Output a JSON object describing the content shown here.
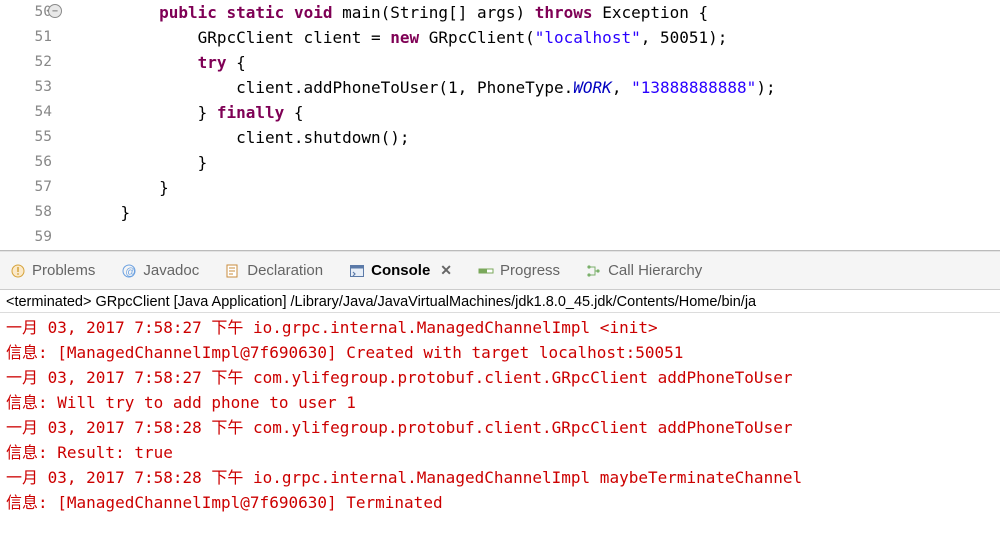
{
  "code": {
    "lines": [
      {
        "num": "50",
        "marker": true,
        "indent": "        ",
        "tokens": [
          {
            "cls": "kw",
            "t": "public"
          },
          {
            "t": " "
          },
          {
            "cls": "kw",
            "t": "static"
          },
          {
            "t": " "
          },
          {
            "cls": "kw",
            "t": "void"
          },
          {
            "t": " main(String[] args) "
          },
          {
            "cls": "kw",
            "t": "throws"
          },
          {
            "t": " Exception {"
          }
        ]
      },
      {
        "num": "51",
        "indent": "            ",
        "tokens": [
          {
            "t": "GRpcClient client = "
          },
          {
            "cls": "kw",
            "t": "new"
          },
          {
            "t": " GRpcClient("
          },
          {
            "cls": "str",
            "t": "\"localhost\""
          },
          {
            "t": ", 50051);"
          }
        ]
      },
      {
        "num": "52",
        "indent": "            ",
        "tokens": [
          {
            "cls": "kw",
            "t": "try"
          },
          {
            "t": " {"
          }
        ]
      },
      {
        "num": "53",
        "indent": "                ",
        "tokens": [
          {
            "t": "client.addPhoneToUser(1, PhoneType."
          },
          {
            "cls": "fld",
            "t": "WORK"
          },
          {
            "t": ", "
          },
          {
            "cls": "str",
            "t": "\"13888888888\""
          },
          {
            "t": ");"
          }
        ]
      },
      {
        "num": "54",
        "indent": "            ",
        "tokens": [
          {
            "t": "} "
          },
          {
            "cls": "kw",
            "t": "finally"
          },
          {
            "t": " {"
          }
        ]
      },
      {
        "num": "55",
        "indent": "                ",
        "tokens": [
          {
            "t": "client.shutdown();"
          }
        ]
      },
      {
        "num": "56",
        "indent": "            ",
        "tokens": [
          {
            "t": "}"
          }
        ]
      },
      {
        "num": "57",
        "indent": "        ",
        "tokens": [
          {
            "t": "}"
          }
        ]
      },
      {
        "num": "58",
        "indent": "    ",
        "tokens": [
          {
            "t": "}"
          }
        ]
      },
      {
        "num": "59",
        "indent": "",
        "tokens": []
      }
    ]
  },
  "tabs": {
    "items": [
      {
        "label": "Problems",
        "icon": "problems-icon",
        "active": false
      },
      {
        "label": "Javadoc",
        "icon": "javadoc-icon",
        "active": false
      },
      {
        "label": "Declaration",
        "icon": "declaration-icon",
        "active": false
      },
      {
        "label": "Console",
        "icon": "console-icon",
        "active": true,
        "closable": true
      },
      {
        "label": "Progress",
        "icon": "progress-icon",
        "active": false
      },
      {
        "label": "Call Hierarchy",
        "icon": "callhierarchy-icon",
        "active": false
      }
    ]
  },
  "console": {
    "header": "<terminated> GRpcClient [Java Application] /Library/Java/JavaVirtualMachines/jdk1.8.0_45.jdk/Contents/Home/bin/ja",
    "lines": [
      "一月 03, 2017 7:58:27 下午 io.grpc.internal.ManagedChannelImpl <init>",
      "信息: [ManagedChannelImpl@7f690630] Created with target localhost:50051",
      "一月 03, 2017 7:58:27 下午 com.ylifegroup.protobuf.client.GRpcClient addPhoneToUser",
      "信息: Will try to add phone to user 1",
      "一月 03, 2017 7:58:28 下午 com.ylifegroup.protobuf.client.GRpcClient addPhoneToUser",
      "信息: Result: true",
      "一月 03, 2017 7:58:28 下午 io.grpc.internal.ManagedChannelImpl maybeTerminateChannel",
      "信息: [ManagedChannelImpl@7f690630] Terminated"
    ]
  }
}
